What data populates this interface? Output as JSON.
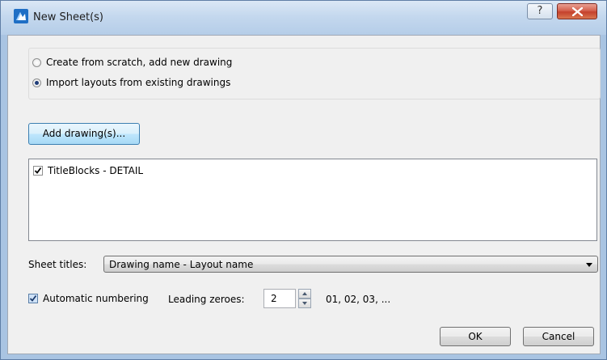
{
  "window": {
    "title": "New Sheet(s)",
    "help_label": "?",
    "app_icon": "bricscad-logo-icon",
    "close_icon": "close-icon"
  },
  "source": {
    "options": [
      {
        "label": "Create from scratch, add new drawing",
        "checked": false
      },
      {
        "label": "Import layouts from existing drawings",
        "checked": true
      }
    ]
  },
  "add_button_label": "Add drawing(s)...",
  "drawings": [
    {
      "label": "TitleBlocks - DETAIL",
      "checked": true
    }
  ],
  "sheet_titles": {
    "label": "Sheet titles:",
    "selected": "Drawing name - Layout name"
  },
  "numbering": {
    "automatic_label": "Automatic numbering",
    "automatic_checked": true,
    "leading_zeroes_label": "Leading zeroes:",
    "leading_zeroes_value": "2",
    "preview": "01, 02, 03, ..."
  },
  "buttons": {
    "ok": "OK",
    "cancel": "Cancel"
  },
  "colors": {
    "title_bar": "#c4d8ee",
    "close_button": "#c5412c",
    "accent": "#3c7fb1"
  }
}
